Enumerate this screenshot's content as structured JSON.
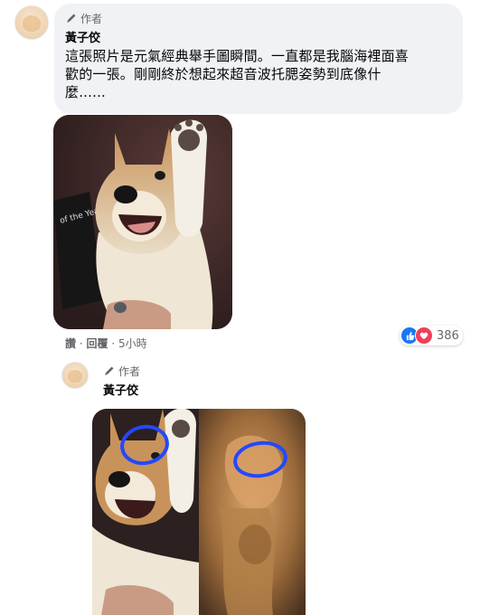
{
  "comment1": {
    "author_badge": "作者",
    "name": "黃子佼",
    "lines": [
      "這張照片是元氣經典舉手圖瞬間。一直都是我腦海裡面喜",
      "歡的一張。剛剛終於想起來超音波托腮姿勢到底像什",
      "麼......"
    ],
    "actions": {
      "like": "讚",
      "sep1": "·",
      "reply": "回覆",
      "sep2": "·",
      "time": "5小時"
    },
    "reaction_count": "386",
    "photo_icons": [
      "dog-photo"
    ]
  },
  "comment2": {
    "author_badge": "作者",
    "name": "黃子佼"
  },
  "colors": {
    "bubble": "#f0f2f5",
    "muted": "#65676b",
    "like_blue": "#1877f2",
    "love_red": "#f33e58",
    "circle_marker": "#2448ff"
  },
  "icons": [
    "pencil-icon",
    "like-reaction-icon",
    "love-reaction-icon"
  ]
}
